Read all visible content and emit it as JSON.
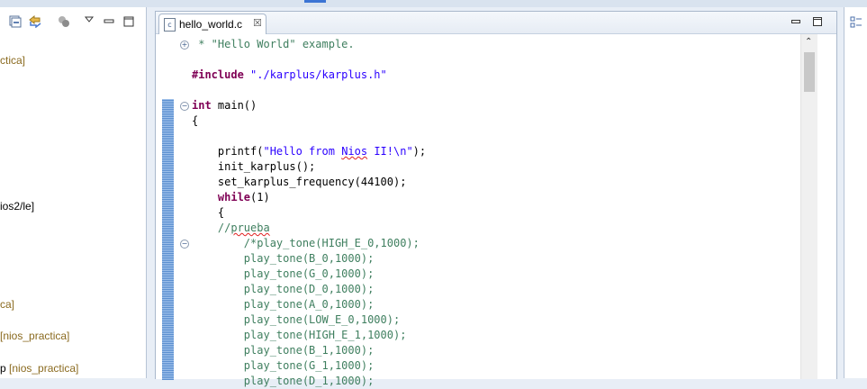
{
  "editor": {
    "tab_label": "hello_world.c",
    "tab_icon": "c-source-file-icon",
    "close_glyph": "☒",
    "code_lines": [
      {
        "segments": [
          {
            "t": " * \"Hello World\" example.",
            "c": "cmt"
          }
        ],
        "fold": "plus"
      },
      {
        "segments": []
      },
      {
        "segments": [
          {
            "t": "#include ",
            "c": "pp"
          },
          {
            "t": "\"./karplus/karplus.h\"",
            "c": "str"
          }
        ]
      },
      {
        "segments": []
      },
      {
        "segments": [
          {
            "t": "int",
            "c": "kw"
          },
          {
            "t": " main()",
            "c": "fn"
          }
        ],
        "fold": "minus"
      },
      {
        "segments": [
          {
            "t": "{",
            "c": "fn"
          }
        ]
      },
      {
        "segments": []
      },
      {
        "segments": [
          {
            "t": "    printf(",
            "c": "fn"
          },
          {
            "t": "\"Hello from ",
            "c": "str"
          },
          {
            "t": "Nios",
            "c": "str sq"
          },
          {
            "t": " II!\\n\"",
            "c": "str"
          },
          {
            "t": ");",
            "c": "fn"
          }
        ]
      },
      {
        "segments": [
          {
            "t": "    init_karplus();",
            "c": "fn"
          }
        ]
      },
      {
        "segments": [
          {
            "t": "    set_karplus_frequency(44100);",
            "c": "fn"
          }
        ]
      },
      {
        "segments": [
          {
            "t": "    ",
            "c": "fn"
          },
          {
            "t": "while",
            "c": "kw"
          },
          {
            "t": "(1)",
            "c": "fn"
          }
        ]
      },
      {
        "segments": [
          {
            "t": "    {",
            "c": "fn"
          }
        ]
      },
      {
        "segments": [
          {
            "t": "    //",
            "c": "cmt"
          },
          {
            "t": "prueba",
            "c": "cmt sq"
          }
        ]
      },
      {
        "segments": [
          {
            "t": "        /*play_tone(HIGH_E_0,1000);",
            "c": "cmt"
          }
        ],
        "fold": "minus"
      },
      {
        "segments": [
          {
            "t": "        play_tone(B_0,1000);",
            "c": "cmt"
          }
        ]
      },
      {
        "segments": [
          {
            "t": "        play_tone(G_0,1000);",
            "c": "cmt"
          }
        ]
      },
      {
        "segments": [
          {
            "t": "        play_tone(D_0,1000);",
            "c": "cmt"
          }
        ]
      },
      {
        "segments": [
          {
            "t": "        play_tone(A_0,1000);",
            "c": "cmt"
          }
        ]
      },
      {
        "segments": [
          {
            "t": "        play_tone(LOW_E_0,1000);",
            "c": "cmt"
          }
        ]
      },
      {
        "segments": [
          {
            "t": "        play_tone(HIGH_E_1,1000);",
            "c": "cmt"
          }
        ]
      },
      {
        "segments": [
          {
            "t": "        play_tone(B_1,1000);",
            "c": "cmt"
          }
        ]
      },
      {
        "segments": [
          {
            "t": "        play_tone(G_1,1000);",
            "c": "cmt"
          }
        ]
      },
      {
        "segments": [
          {
            "t": "        play_tone(D_1,1000);",
            "c": "cmt"
          }
        ]
      }
    ]
  },
  "left_pane": {
    "items": [
      {
        "text": "ctica]",
        "decorated": true
      },
      {
        "text": "ios2/le]",
        "decorated": false
      },
      {
        "text": "ca]",
        "decorated": true
      },
      {
        "text": "[nios_practica]",
        "decorated": true
      },
      {
        "text": "p [nios_practica]",
        "prefix": "p ",
        "suffix": "[nios_practica]",
        "decorated": true
      }
    ]
  },
  "colors": {
    "keyword": "#7f0055",
    "string": "#2a00ff",
    "comment": "#3f7f5f",
    "project_decoration": "#8a6a1f"
  }
}
